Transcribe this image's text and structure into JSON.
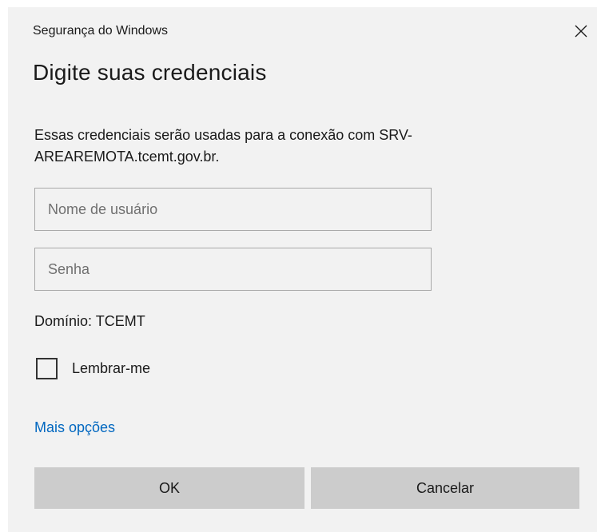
{
  "window": {
    "title": "Segurança do Windows"
  },
  "dialog": {
    "heading": "Digite suas credenciais",
    "description": "Essas credenciais serão usadas para a conexão com SRV-AREAREMOTA.tcemt.gov.br."
  },
  "fields": {
    "username": {
      "placeholder": "Nome de usuário",
      "value": ""
    },
    "password": {
      "placeholder": "Senha",
      "value": ""
    }
  },
  "domain_text": "Domínio: TCEMT",
  "remember": {
    "label": "Lembrar-me",
    "checked": false
  },
  "more_options": "Mais opções",
  "buttons": {
    "ok": "OK",
    "cancel": "Cancelar"
  },
  "colors": {
    "dialog_background": "#f2f2f2",
    "button_background": "#cccccc",
    "link": "#0067c0",
    "field_border": "#a9a9a9"
  },
  "icons": {
    "close": "close-icon"
  }
}
